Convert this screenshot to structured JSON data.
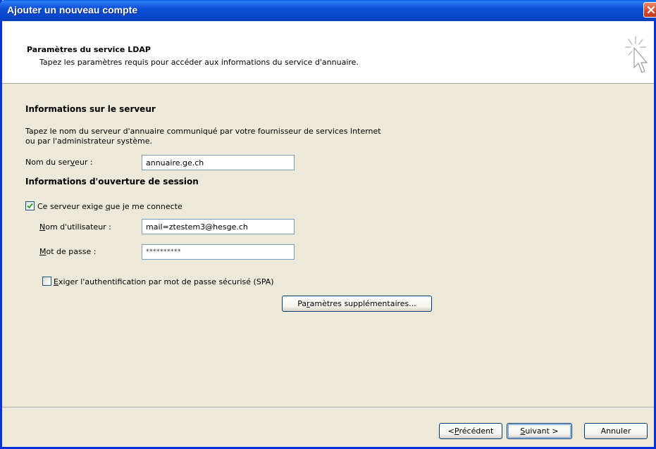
{
  "window": {
    "title": "Ajouter un nouveau compte",
    "titlebar_color": "#0a4fd8",
    "close_color": "#d8452a"
  },
  "header": {
    "title": "Paramètres du service LDAP",
    "description": "Tapez les paramètres requis pour accéder aux informations du service d'annuaire."
  },
  "server_section": {
    "title": "Informations sur le serveur",
    "description_line1": "Tapez le nom du serveur d'annuaire communiqué par votre fournisseur de services Internet",
    "description_line2": "ou par l'administrateur système.",
    "server_label_pre": "Nom du ser",
    "server_label_accel": "v",
    "server_label_post": "eur :",
    "server_value": "annuaire.ge.ch"
  },
  "logon_section": {
    "title": "Informations d'ouverture de session",
    "require_logon_pre": "Ce serveur exige ",
    "require_logon_accel": "q",
    "require_logon_post": "ue je me connecte",
    "require_logon_checked": true,
    "username_label_accel": "N",
    "username_label_rest": "om d'utilisateur :",
    "username_value": "mail=ztestem3@hesge.ch",
    "password_label_accel": "M",
    "password_label_rest": "ot de passe :",
    "password_value": "**********",
    "spa_label_accel": "E",
    "spa_label_rest": "xiger l'authentification par mot de passe sécurisé (SPA)",
    "spa_checked": false,
    "more_settings_pre": "Pa",
    "more_settings_accel": "r",
    "more_settings_post": "amètres supplémentaires..."
  },
  "footer": {
    "back_pre": "< ",
    "back_accel": "P",
    "back_post": "récédent",
    "next_accel": "S",
    "next_post": "uivant >",
    "cancel": "Annuler"
  }
}
